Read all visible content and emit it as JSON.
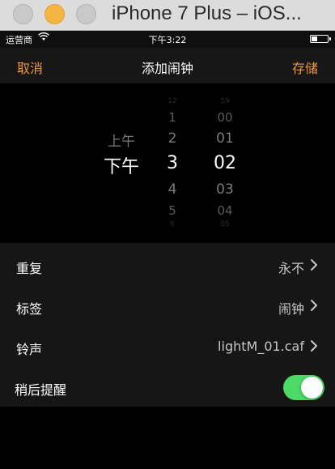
{
  "window": {
    "title": "iPhone 7 Plus – iOS..."
  },
  "statusbar": {
    "carrier": "运营商",
    "time": "下午3:22"
  },
  "navbar": {
    "cancel_label": "取消",
    "title": "添加闹钟",
    "save_label": "存储",
    "accent_color": "#f0963a"
  },
  "picker": {
    "ampm": {
      "above": "上午",
      "selected": "下午"
    },
    "hours": {
      "above": [
        "12",
        "1",
        "2"
      ],
      "selected": "3",
      "below": [
        "4",
        "5",
        "6"
      ]
    },
    "minutes": {
      "above": [
        "59",
        "00",
        "01"
      ],
      "selected": "02",
      "below": [
        "03",
        "04",
        "05"
      ]
    }
  },
  "settings": {
    "rows": [
      {
        "label": "重复",
        "value": "永不"
      },
      {
        "label": "标签",
        "value": "闹钟"
      },
      {
        "label": "铃声",
        "value": "lightM_01.caf"
      },
      {
        "label": "稍后提醒",
        "toggle_on": true
      }
    ],
    "toggle_color": "#4cd964"
  }
}
